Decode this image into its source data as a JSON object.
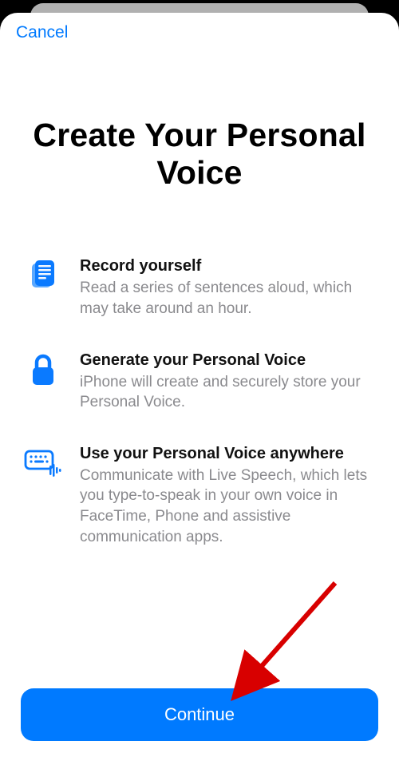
{
  "header": {
    "cancel_label": "Cancel"
  },
  "title": "Create Your Personal Voice",
  "features": [
    {
      "title": "Record yourself",
      "desc": "Read a series of sentences aloud, which may take around an hour."
    },
    {
      "title": "Generate your Personal Voice",
      "desc": "iPhone will create and securely store your Personal Voice."
    },
    {
      "title": "Use your Personal Voice anywhere",
      "desc": "Communicate with Live Speech, which lets you type-to-speak in your own voice in FaceTime, Phone and assistive communication apps."
    }
  ],
  "continue_label": "Continue"
}
